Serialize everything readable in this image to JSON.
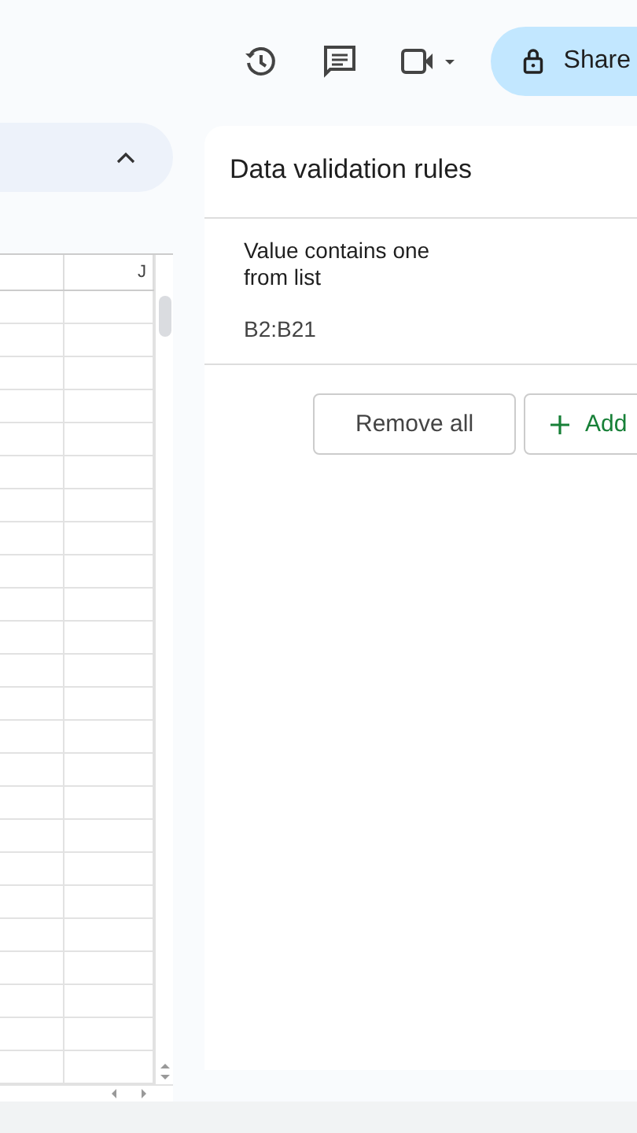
{
  "toolbar": {
    "share_label": "Share"
  },
  "sheet": {
    "column_header": "J"
  },
  "panel": {
    "title": "Data validation rules",
    "rules": [
      {
        "condition": "Value contains one from list",
        "range": "B2:B21"
      }
    ],
    "buttons": [
      {
        "kind": "outline",
        "label": "Remove all"
      },
      {
        "kind": "add",
        "label": "Add"
      }
    ]
  }
}
